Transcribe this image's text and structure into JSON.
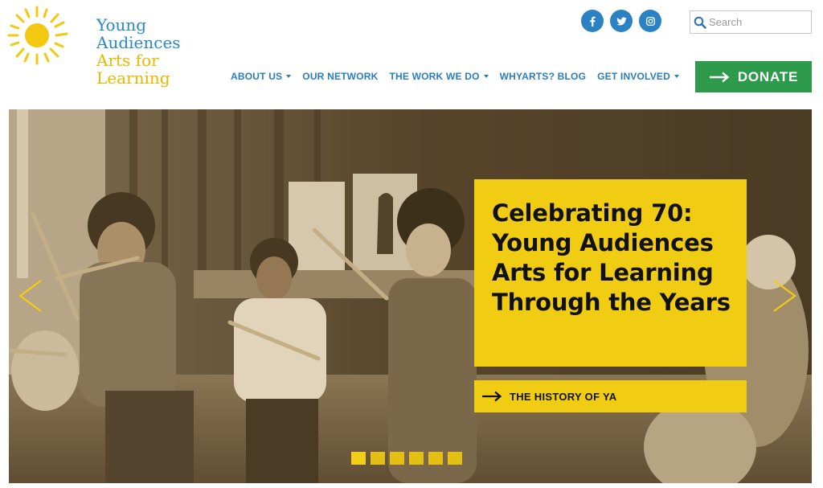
{
  "logo": {
    "line1": "Young",
    "line2": "Audiences",
    "line3": "Arts for",
    "line4": "Learning",
    "sun_color": "#f2c811"
  },
  "social": [
    {
      "name": "facebook-icon"
    },
    {
      "name": "twitter-icon"
    },
    {
      "name": "instagram-icon"
    }
  ],
  "search": {
    "placeholder": "Search",
    "value": ""
  },
  "nav": {
    "items": [
      {
        "label": "ABOUT US",
        "has_dropdown": true
      },
      {
        "label": "OUR NETWORK",
        "has_dropdown": false
      },
      {
        "label": "THE WORK WE DO",
        "has_dropdown": true
      },
      {
        "label": "WHYARTS? BLOG",
        "has_dropdown": false
      },
      {
        "label": "GET INVOLVED",
        "has_dropdown": true
      }
    ]
  },
  "donate": {
    "label": "DONATE",
    "color": "#2e9a4c"
  },
  "hero": {
    "headline": "Celebrating 70: Young Audiences Arts for Learning Through the Years",
    "cta_label": "THE HISTORY OF YA",
    "accent": "#f0cc13",
    "slide_count": 6
  },
  "colors": {
    "link_blue": "#2a7dbd",
    "social_blue": "#2a82c4"
  }
}
